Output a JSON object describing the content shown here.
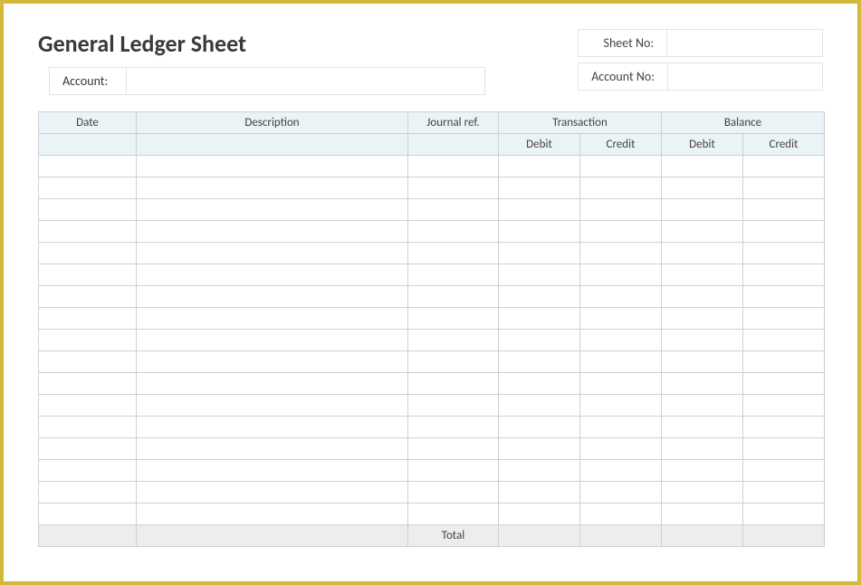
{
  "title": "General Ledger Sheet",
  "fields": {
    "sheet_no_label": "Sheet No:",
    "sheet_no_value": "",
    "account_label": "Account:",
    "account_value": "",
    "account_no_label": "Account No:",
    "account_no_value": ""
  },
  "table": {
    "headers": {
      "date": "Date",
      "description": "Description",
      "journal": "Journal ref.",
      "transaction": "Transaction",
      "balance": "Balance"
    },
    "subheaders": {
      "debit": "Debit",
      "credit": "Credit"
    },
    "total_label": "Total",
    "rows": [
      {
        "date": "",
        "description": "",
        "journal": "",
        "t_debit": "",
        "t_credit": "",
        "b_debit": "",
        "b_credit": ""
      },
      {
        "date": "",
        "description": "",
        "journal": "",
        "t_debit": "",
        "t_credit": "",
        "b_debit": "",
        "b_credit": ""
      },
      {
        "date": "",
        "description": "",
        "journal": "",
        "t_debit": "",
        "t_credit": "",
        "b_debit": "",
        "b_credit": ""
      },
      {
        "date": "",
        "description": "",
        "journal": "",
        "t_debit": "",
        "t_credit": "",
        "b_debit": "",
        "b_credit": ""
      },
      {
        "date": "",
        "description": "",
        "journal": "",
        "t_debit": "",
        "t_credit": "",
        "b_debit": "",
        "b_credit": ""
      },
      {
        "date": "",
        "description": "",
        "journal": "",
        "t_debit": "",
        "t_credit": "",
        "b_debit": "",
        "b_credit": ""
      },
      {
        "date": "",
        "description": "",
        "journal": "",
        "t_debit": "",
        "t_credit": "",
        "b_debit": "",
        "b_credit": ""
      },
      {
        "date": "",
        "description": "",
        "journal": "",
        "t_debit": "",
        "t_credit": "",
        "b_debit": "",
        "b_credit": ""
      },
      {
        "date": "",
        "description": "",
        "journal": "",
        "t_debit": "",
        "t_credit": "",
        "b_debit": "",
        "b_credit": ""
      },
      {
        "date": "",
        "description": "",
        "journal": "",
        "t_debit": "",
        "t_credit": "",
        "b_debit": "",
        "b_credit": ""
      },
      {
        "date": "",
        "description": "",
        "journal": "",
        "t_debit": "",
        "t_credit": "",
        "b_debit": "",
        "b_credit": ""
      },
      {
        "date": "",
        "description": "",
        "journal": "",
        "t_debit": "",
        "t_credit": "",
        "b_debit": "",
        "b_credit": ""
      },
      {
        "date": "",
        "description": "",
        "journal": "",
        "t_debit": "",
        "t_credit": "",
        "b_debit": "",
        "b_credit": ""
      },
      {
        "date": "",
        "description": "",
        "journal": "",
        "t_debit": "",
        "t_credit": "",
        "b_debit": "",
        "b_credit": ""
      },
      {
        "date": "",
        "description": "",
        "journal": "",
        "t_debit": "",
        "t_credit": "",
        "b_debit": "",
        "b_credit": ""
      },
      {
        "date": "",
        "description": "",
        "journal": "",
        "t_debit": "",
        "t_credit": "",
        "b_debit": "",
        "b_credit": ""
      },
      {
        "date": "",
        "description": "",
        "journal": "",
        "t_debit": "",
        "t_credit": "",
        "b_debit": "",
        "b_credit": ""
      }
    ],
    "totals": {
      "t_debit": "",
      "t_credit": "",
      "b_debit": "",
      "b_credit": ""
    }
  }
}
